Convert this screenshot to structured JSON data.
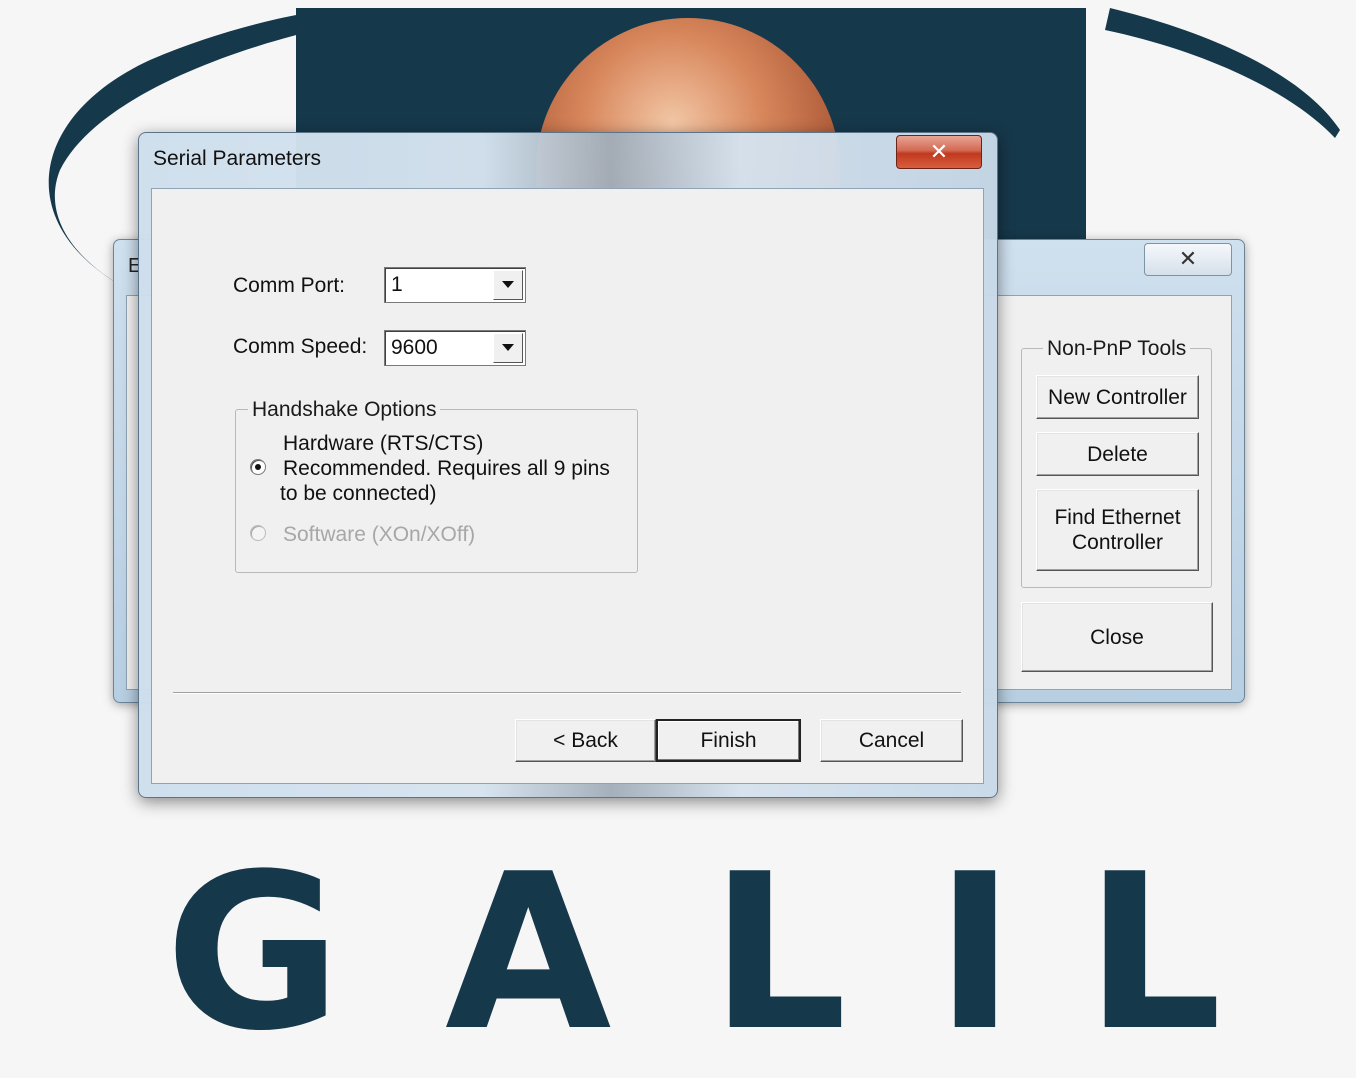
{
  "background": {
    "logo_letters": [
      "G",
      "A",
      "L",
      "I",
      "L"
    ],
    "colors": {
      "logo": "#16384b",
      "sphere": "#c8704a"
    }
  },
  "back_window": {
    "title_fragment": "E",
    "close_icon": "close-x-icon",
    "group_label": "Non-PnP Tools",
    "buttons": {
      "new_controller": "New Controller",
      "delete": "Delete",
      "find_ethernet_line1": "Find Ethernet",
      "find_ethernet_line2": "Controller",
      "close": "Close"
    }
  },
  "dialog": {
    "title": "Serial Parameters",
    "close_icon": "close-x-icon",
    "comm_port": {
      "label": "Comm Port:",
      "value": "1"
    },
    "comm_speed": {
      "label": "Comm Speed:",
      "value": "9600"
    },
    "handshake": {
      "group_label": "Handshake Options",
      "hardware_line1": "Hardware (RTS/CTS)",
      "hardware_line2": "Recommended.  Requires all 9 pins",
      "hardware_line3": "to be connected)",
      "software": "Software (XOn/XOff)",
      "selected": "hardware"
    },
    "buttons": {
      "back": "< Back",
      "finish": "Finish",
      "cancel": "Cancel"
    }
  }
}
